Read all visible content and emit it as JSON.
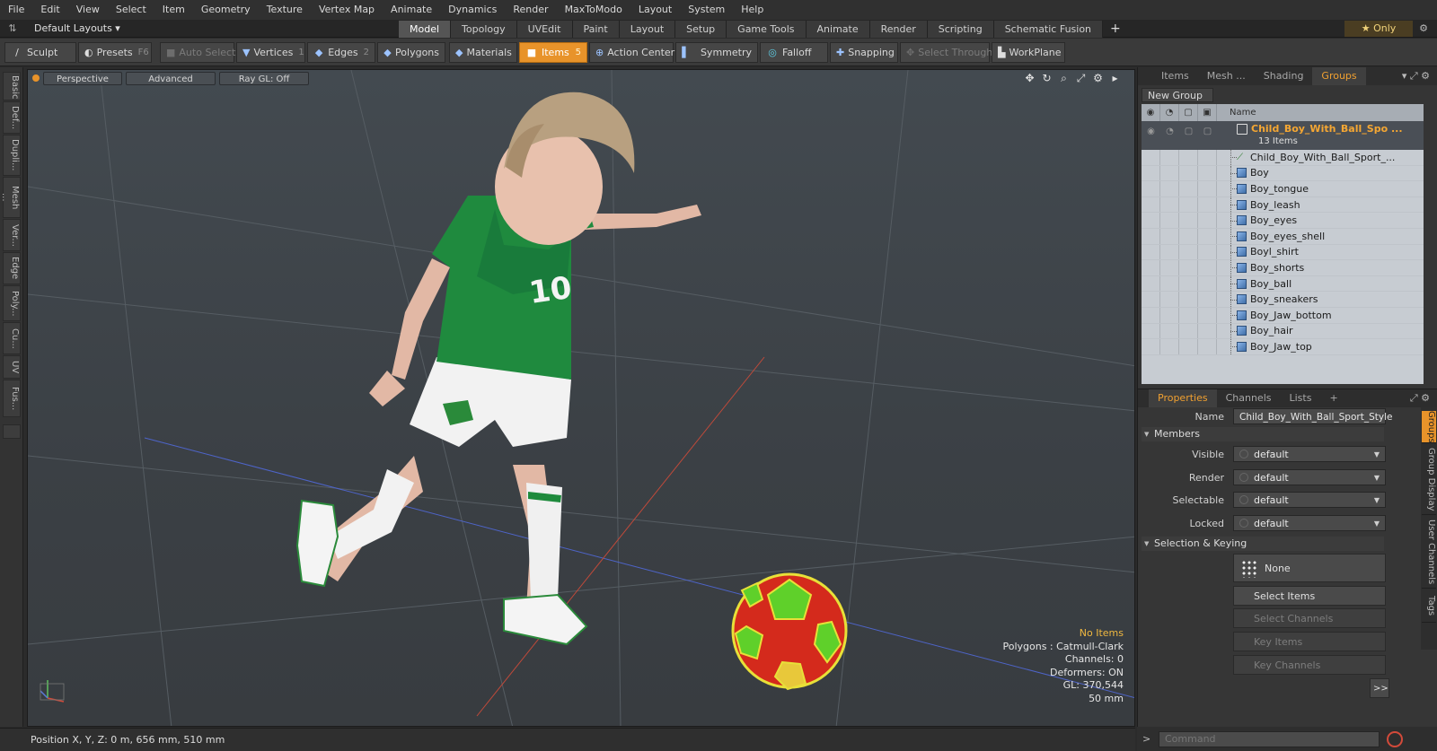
{
  "menu": [
    "File",
    "Edit",
    "View",
    "Select",
    "Item",
    "Geometry",
    "Texture",
    "Vertex Map",
    "Animate",
    "Dynamics",
    "Render",
    "MaxToModo",
    "Layout",
    "System",
    "Help"
  ],
  "layout_select": "Default Layouts ▾",
  "tabs": [
    "Model",
    "Topology",
    "UVEdit",
    "Paint",
    "Layout",
    "Setup",
    "Game Tools",
    "Animate",
    "Render",
    "Scripting",
    "Schematic Fusion"
  ],
  "active_tab": "Model",
  "only_label": "★  Only",
  "toolbar": {
    "sculpt": "Sculpt",
    "presets": "Presets",
    "presets_key": "F6",
    "auto_select": "Auto Select",
    "vertices": "Vertices",
    "vertices_key": "1",
    "edges": "Edges",
    "edges_key": "2",
    "polygons": "Polygons",
    "materials": "Materials",
    "items": "Items",
    "items_key": "5",
    "action_center": "Action Center",
    "symmetry": "Symmetry",
    "falloff": "Falloff",
    "snapping": "Snapping",
    "select_through": "Select Through",
    "workplane": "WorkPlane"
  },
  "left_tabs": [
    "Basic",
    "Def...",
    "Dupli...",
    "Mesh ...",
    "Ver...",
    "Edge",
    "Poly...",
    "Cu...",
    "UV",
    "Fus..."
  ],
  "viewport": {
    "perspective": "Perspective",
    "advanced": "Advanced",
    "raygl": "Ray GL: Off",
    "info": {
      "no_items": "No Items",
      "polygons": "Polygons : Catmull-Clark",
      "channels": "Channels: 0",
      "deformers": "Deformers: ON",
      "gl": "GL: 370,544",
      "scale": "50 mm"
    }
  },
  "status": {
    "position": "Position X, Y, Z:  0 m, 656 mm, 510 mm"
  },
  "right_top": {
    "tabs": [
      "Items",
      "Mesh ...",
      "Shading",
      "Groups"
    ],
    "active_tab": "Groups",
    "new_group": "New Group",
    "name_col": "Name",
    "group": {
      "name": "Child_Boy_With_Ball_Spo ...",
      "count": "13 Items"
    },
    "items": [
      "Child_Boy_With_Ball_Sport_...",
      "Boy",
      "Boy_tongue",
      "Boy_leash",
      "Boy_eyes",
      "Boy_eyes_shell",
      "Boyl_shirt",
      "Boy_shorts",
      "Boy_ball",
      "Boy_sneakers",
      "Boy_Jaw_bottom",
      "Boy_hair",
      "Boy_Jaw_top"
    ]
  },
  "right_bottom": {
    "tabs": [
      "Properties",
      "Channels",
      "Lists"
    ],
    "active_tab": "Properties",
    "side_tabs": [
      "Groups",
      "Group Display",
      "User Channels",
      "Tags"
    ],
    "name_label": "Name",
    "name_value": "Child_Boy_With_Ball_Sport_Style",
    "members": "Members",
    "visible_label": "Visible",
    "visible_value": "default",
    "render_label": "Render",
    "render_value": "default",
    "selectable_label": "Selectable",
    "selectable_value": "default",
    "locked_label": "Locked",
    "locked_value": "default",
    "selection_keying": "Selection & Keying",
    "none": "None",
    "select_items": "Select Items",
    "select_channels": "Select Channels",
    "key_items": "Key Items",
    "key_channels": "Key Channels",
    "more": ">>"
  },
  "command_placeholder": "Command"
}
